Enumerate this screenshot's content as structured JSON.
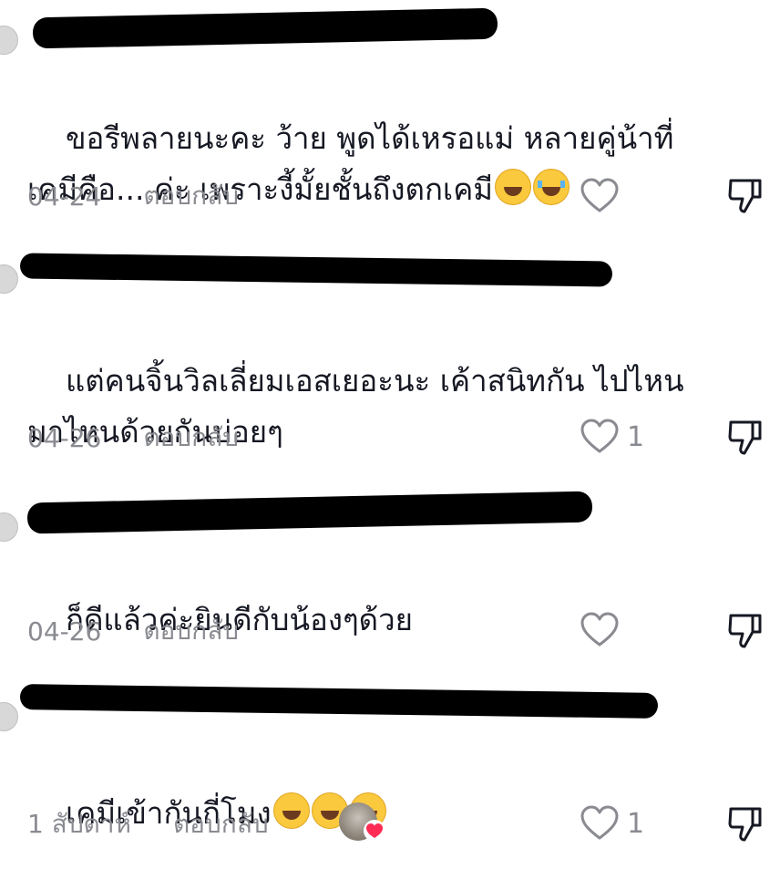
{
  "comments": [
    {
      "text": "ขอรีพลายนะคะ ว้าย พูดได้เหรอแม่ หลายคู่น้าที่\nเคมีคือ... ค่ะ เพราะงี้มั้ยชั้นถึงตกเคมี",
      "emojis": [
        "laughing-tears",
        "crying"
      ],
      "date": "04-24",
      "reply": "ตอบกลับ",
      "likes": ""
    },
    {
      "text": "แต่คนจิ้นวิลเลี่ยมเอสเยอะนะ เค้าสนิทกัน ไปไหน\nมาไหนด้วยกันบ่อยๆ",
      "emojis": [],
      "date": "04-26",
      "reply": "ตอบกลับ",
      "likes": "1"
    },
    {
      "text": "ก็ดีแล้วค่ะยินดีกับน้องๆด้วย",
      "emojis": [],
      "date": "04-26",
      "reply": "ตอบกลับ",
      "likes": ""
    },
    {
      "text": "เคมีเข้ากันกี่โมง",
      "emojis": [
        "laughing-tears",
        "laughing-tears",
        "laughing-tears"
      ],
      "date": "1 สัปดาห์",
      "reply": "ตอบกลับ",
      "likes": "1"
    }
  ],
  "colors": {
    "text": "#161823",
    "meta": "#8a8b91",
    "heart_badge": "#fe2c55",
    "redaction": "#000000"
  },
  "icons": {
    "like": "heart-outline-icon",
    "dislike": "thumbs-down-outline-icon",
    "creator_like": "creator-liked-heart-icon"
  }
}
